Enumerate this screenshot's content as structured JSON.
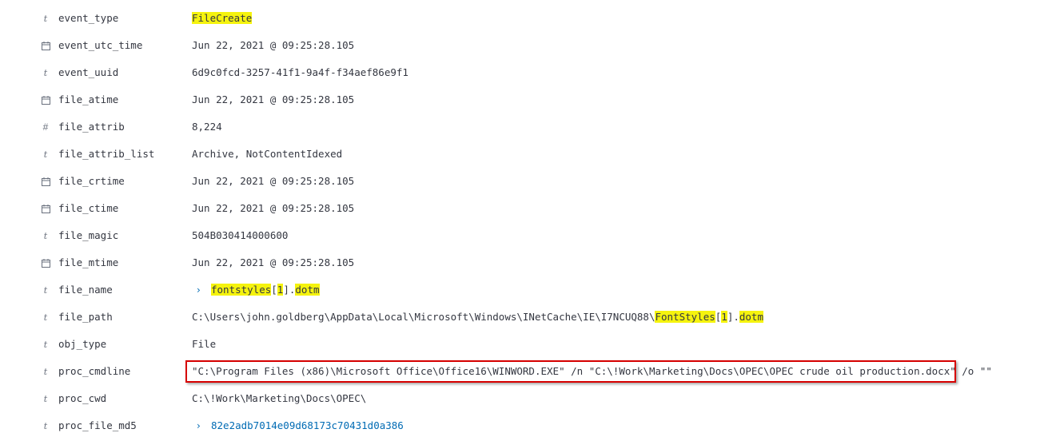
{
  "fields": [
    {
      "icon": "string-type-icon",
      "name": "event_type",
      "value": "FileCreate"
    },
    {
      "icon": "date-type-icon",
      "name": "event_utc_time",
      "value": "Jun 22, 2021 @ 09:25:28.105"
    },
    {
      "icon": "string-type-icon",
      "name": "event_uuid",
      "value": "6d9c0fcd-3257-41f1-9a4f-f34aef86e9f1"
    },
    {
      "icon": "date-type-icon",
      "name": "file_atime",
      "value": "Jun 22, 2021 @ 09:25:28.105"
    },
    {
      "icon": "number-type-icon",
      "name": "file_attrib",
      "value": "8,224"
    },
    {
      "icon": "string-type-icon",
      "name": "file_attrib_list",
      "value": "Archive, NotContentIdexed"
    },
    {
      "icon": "date-type-icon",
      "name": "file_crtime",
      "value": "Jun 22, 2021 @ 09:25:28.105"
    },
    {
      "icon": "date-type-icon",
      "name": "file_ctime",
      "value": "Jun 22, 2021 @ 09:25:28.105"
    },
    {
      "icon": "string-type-icon",
      "name": "file_magic",
      "value": "504B030414000600"
    },
    {
      "icon": "date-type-icon",
      "name": "file_mtime",
      "value": "Jun 22, 2021 @ 09:25:28.105"
    },
    {
      "icon": "string-type-icon",
      "name": "file_name",
      "value_parts": [
        "fontstyles",
        "[",
        "1",
        "].",
        "dotm"
      ]
    },
    {
      "icon": "string-type-icon",
      "name": "file_path",
      "value_parts": [
        "C:\\Users\\john.goldberg\\AppData\\Local\\Microsoft\\Windows\\INetCache\\IE\\I7NCUQ88\\",
        "FontStyles",
        "[",
        "1",
        "].",
        "dotm"
      ]
    },
    {
      "icon": "string-type-icon",
      "name": "obj_type",
      "value": "File"
    },
    {
      "icon": "string-type-icon",
      "name": "proc_cmdline",
      "value": "\"C:\\Program Files (x86)\\Microsoft Office\\Office16\\WINWORD.EXE\" /n \"C:\\!Work\\Marketing\\Docs\\OPEC\\OPEC crude oil production.docx\" /o \"\""
    },
    {
      "icon": "string-type-icon",
      "name": "proc_cwd",
      "value": "C:\\!Work\\Marketing\\Docs\\OPEC\\"
    },
    {
      "icon": "string-type-icon",
      "name": "proc_file_md5",
      "value": "82e2adb7014e09d68173c70431d0a386"
    }
  ],
  "glyphs": {
    "string": "t",
    "number": "#",
    "chevron": "›"
  },
  "colors": {
    "highlight": "#f5f30e",
    "link": "#006bb4",
    "annotation_box": "#d60000"
  }
}
